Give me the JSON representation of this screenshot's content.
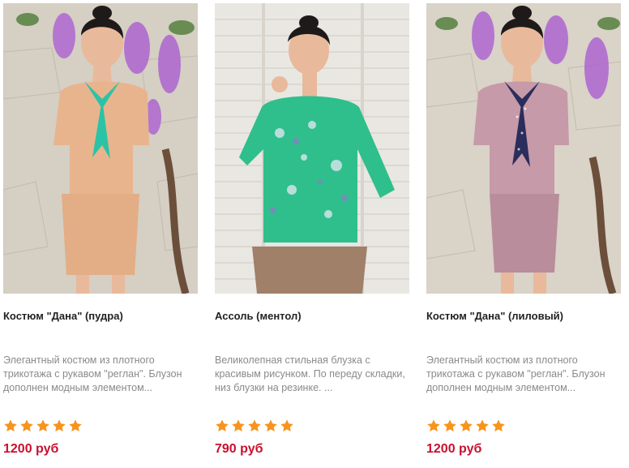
{
  "products": [
    {
      "title": "Костюм \"Дана\" (пудра)",
      "description": "Элегантный костюм из плотного трикотажа с рукавом \"реглан\". Блузон дополнен модным элементом...",
      "rating": 5,
      "price": "1200 руб",
      "colors": {
        "garment": "#e8b48e",
        "accent": "#2bc3a6",
        "background": "#d9d3c8"
      }
    },
    {
      "title": "Ассоль (ментол)",
      "description": "Великолепная стильная блузка с красивым рисунком. По переду складки, низ блузки на резинке. ...",
      "rating": 5,
      "price": "790 руб",
      "colors": {
        "garment": "#2fbf8c",
        "accent": "#a08068",
        "background": "#e9e7e2"
      }
    },
    {
      "title": "Костюм \"Дана\" (лиловый)",
      "description": "Элегантный костюм из плотного трикотажа с рукавом \"реглан\". Блузон дополнен модным элементом...",
      "rating": 5,
      "price": "1200 руб",
      "colors": {
        "garment": "#c69aa8",
        "accent": "#2b2d5c",
        "background": "#d9d3c8"
      }
    }
  ],
  "theme": {
    "price_color": "#c8102e",
    "star_color": "#f7941d",
    "text_muted": "#8a8a8a"
  }
}
